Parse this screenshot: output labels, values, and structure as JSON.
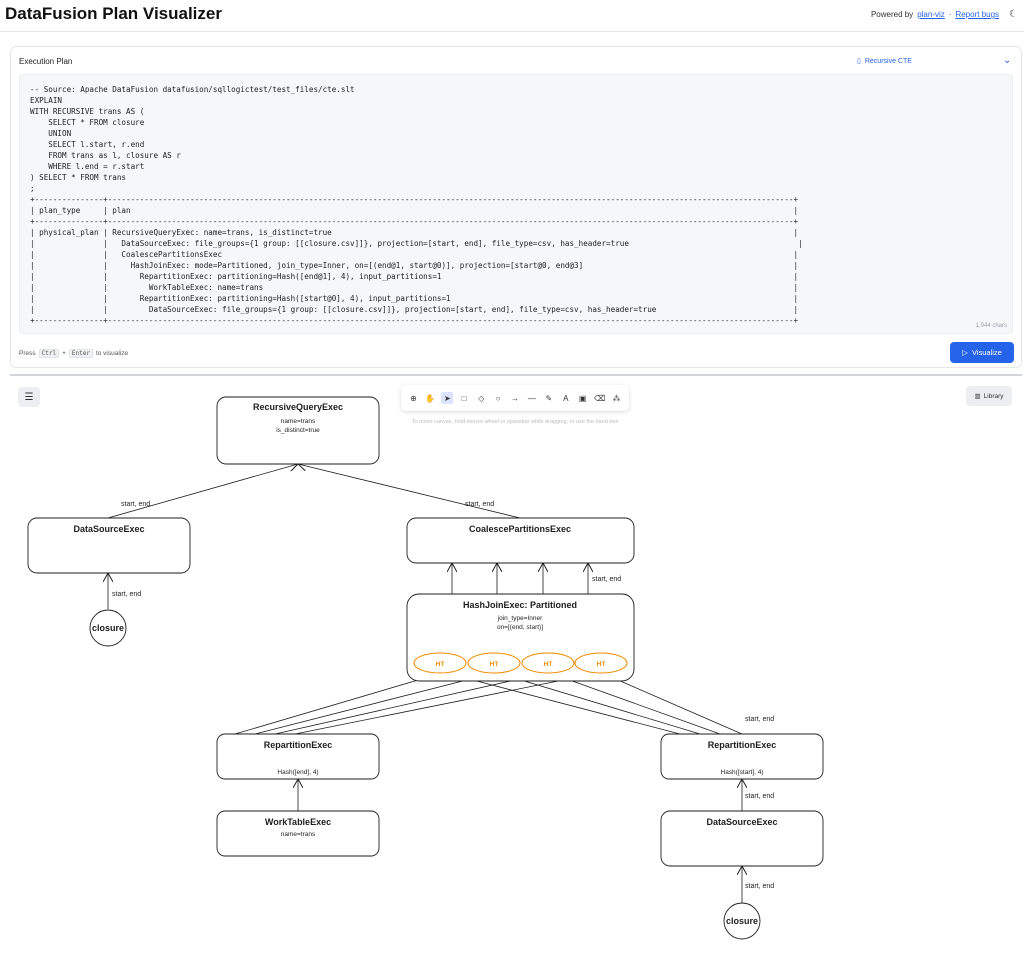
{
  "header": {
    "title": "DataFusion Plan Visualizer",
    "powered_by": "Powered by",
    "powered_link": "plan-viz",
    "separator": "·",
    "report_bugs": "Report bugs",
    "theme_icon": "moon-icon"
  },
  "plan_panel": {
    "title": "Execution Plan",
    "preset": "Recursive CTE",
    "code": "-- Source: Apache DataFusion datafusion/sqllogictest/test_files/cte.slt\nEXPLAIN\nWITH RECURSIVE trans AS (\n    SELECT * FROM closure\n    UNION\n    SELECT l.start, r.end\n    FROM trans as l, closure AS r\n    WHERE l.end = r.start\n) SELECT * FROM trans\n;\n+---------------+------------------------------------------------------------------------------------------------------------------------------------------------------+\n| plan_type     | plan                                                                                                                                                 |\n+---------------+------------------------------------------------------------------------------------------------------------------------------------------------------+\n| physical_plan | RecursiveQueryExec: name=trans, is_distinct=true                                                                                                     |\n|               |   DataSourceExec: file_groups={1 group: [[closure.csv]]}, projection=[start, end], file_type=csv, has_header=true                                     |\n|               |   CoalescePartitionsExec                                                                                                                             |\n|               |     HashJoinExec: mode=Partitioned, join_type=Inner, on=[(end@1, start@0)], projection=[start@0, end@3]                                              |\n|               |       RepartitionExec: partitioning=Hash([end@1], 4), input_partitions=1                                                                             |\n|               |         WorkTableExec: name=trans                                                                                                                    |\n|               |       RepartitionExec: partitioning=Hash([start@0], 4), input_partitions=1                                                                           |\n|               |         DataSourceExec: file_groups={1 group: [[closure.csv]]}, projection=[start, end], file_type=csv, has_header=true                              |\n+---------------+------------------------------------------------------------------------------------------------------------------------------------------------------+",
    "char_count": "1,944 chars",
    "hint_press": "Press",
    "hint_key1": "Ctrl",
    "hint_plus": "+",
    "hint_key2": "Enter",
    "hint_suffix": "to visualize",
    "visualize_label": "Visualize"
  },
  "canvas": {
    "library_label": "Library",
    "tool_hint": "To move canvas, hold mouse wheel or spacebar while dragging, or use the hand tool",
    "tools": [
      "lock-icon",
      "hand-icon",
      "pointer-icon",
      "rectangle-icon",
      "diamond-icon",
      "ellipse-icon",
      "arrow-icon",
      "line-icon",
      "pencil-icon",
      "text-icon",
      "image-icon",
      "eraser-icon",
      "shapes-icon"
    ]
  },
  "diagram": {
    "nodes": {
      "recursive": {
        "title": "RecursiveQueryExec",
        "line1": "name=trans",
        "line2": "is_distinct=true"
      },
      "datasource_left": {
        "title": "DataSourceExec"
      },
      "coalesce": {
        "title": "CoalescePartitionsExec"
      },
      "hashjoin": {
        "title": "HashJoinExec: Partitioned",
        "line1": "join_type=Inner",
        "line2": "on=[(end, start)]"
      },
      "repart_left": {
        "title": "RepartitionExec",
        "line1": "Hash([end], 4)"
      },
      "repart_right": {
        "title": "RepartitionExec",
        "line1": "Hash([start], 4)"
      },
      "worktable": {
        "title": "WorkTableExec",
        "line1": "name=trans"
      },
      "datasource_right": {
        "title": "DataSourceExec"
      },
      "closure_left": {
        "label": "closure"
      },
      "closure_right": {
        "label": "closure"
      }
    },
    "ht_label": "HT",
    "edges": {
      "ds_to_rec": "start, end",
      "co_to_rec": "start, end",
      "cl_to_ds": "start, end",
      "hj_to_co": "start, end",
      "rr_to_hj": "start, end",
      "dsr_to_rr": "start, end",
      "clr_to_dsr": "start, end"
    },
    "colors": {
      "ht": "#f08c00",
      "stroke": "#1e1e1e"
    }
  }
}
